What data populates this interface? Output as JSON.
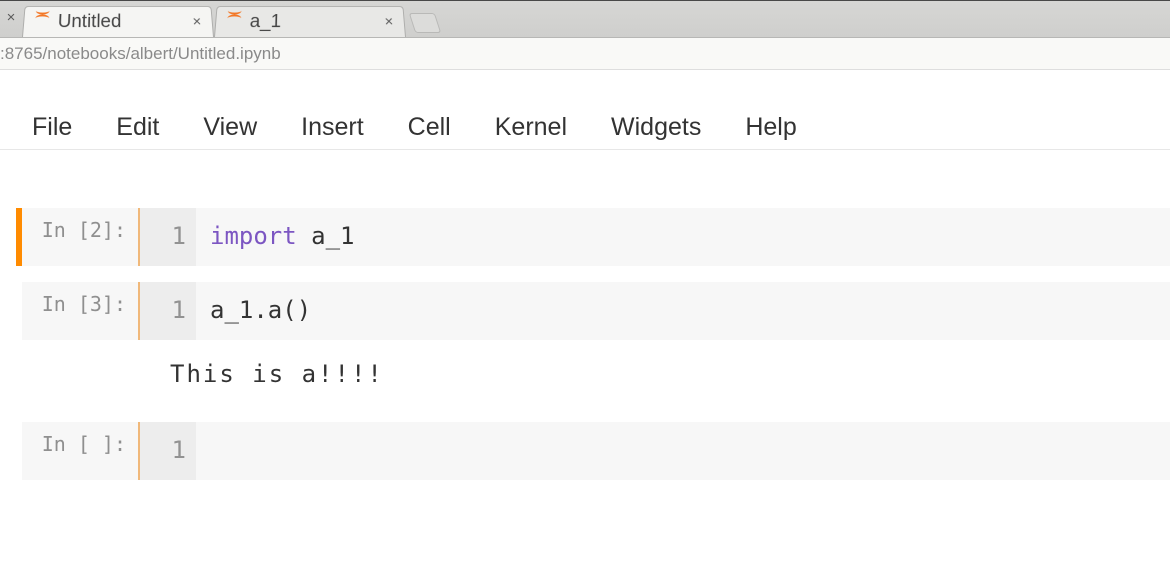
{
  "browser": {
    "tabs": [
      {
        "title": "Untitled"
      },
      {
        "title": "a_1"
      }
    ],
    "url": ":8765/notebooks/albert/Untitled.ipynb"
  },
  "menu": {
    "items": [
      "File",
      "Edit",
      "View",
      "Insert",
      "Cell",
      "Kernel",
      "Widgets",
      "Help"
    ]
  },
  "cells": [
    {
      "prompt": "In [2]:",
      "line_no": "1",
      "code_keyword": "import",
      "code_rest": " a_1",
      "selected": true,
      "output": null
    },
    {
      "prompt": "In [3]:",
      "line_no": "1",
      "code_keyword": "",
      "code_rest": "a_1.a()",
      "selected": false,
      "output": "This is a!!!!"
    },
    {
      "prompt": "In [ ]:",
      "line_no": "1",
      "code_keyword": "",
      "code_rest": "",
      "selected": false,
      "output": null
    }
  ]
}
